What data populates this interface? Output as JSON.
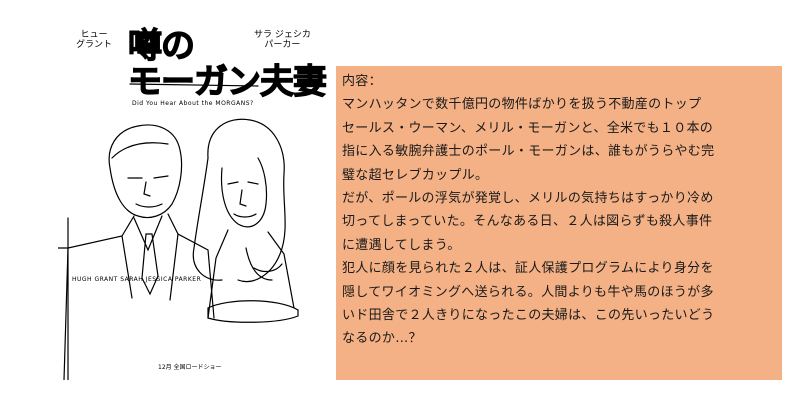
{
  "poster": {
    "actor_left": [
      "ヒュー",
      "グラント"
    ],
    "actor_right": [
      "サラ ジェシカ",
      "パーカー"
    ],
    "title_jp_line1": "噂の",
    "title_jp_line2": "モーガン夫妻",
    "title_en": "Did You Hear About the MORGANS?",
    "names_line": "HUGH GRANT  SARAH JESSICA PARKER",
    "bottom_credit": "12月 全国ロードショー"
  },
  "synopsis": {
    "heading": "内容：",
    "lines": [
      "マンハッタンで数千億円の物件ばかりを扱う不動産のトップ",
      "セールス・ウーマン、メリル・モーガンと、全米でも１０本の",
      "指に入る敏腕弁護士のポール・モーガンは、誰もがうらやむ完",
      "璧な超セレブカップル。",
      "だが、ポールの浮気が発覚し、メリルの気持ちはすっかり冷め",
      "切ってしまっていた。そんなある日、２人は図らずも殺人事件",
      "に遭遇してしまう。",
      "犯人に顔を見られた２人は、証人保護プログラムにより身分を",
      "隠してワイオミングへ送られる。人間よりも牛や馬のほうが多",
      "いド田舎で２人きりになったこの夫婦は、この先いったいどう",
      "なるのか…？"
    ],
    "background_color": "#f4b186"
  }
}
